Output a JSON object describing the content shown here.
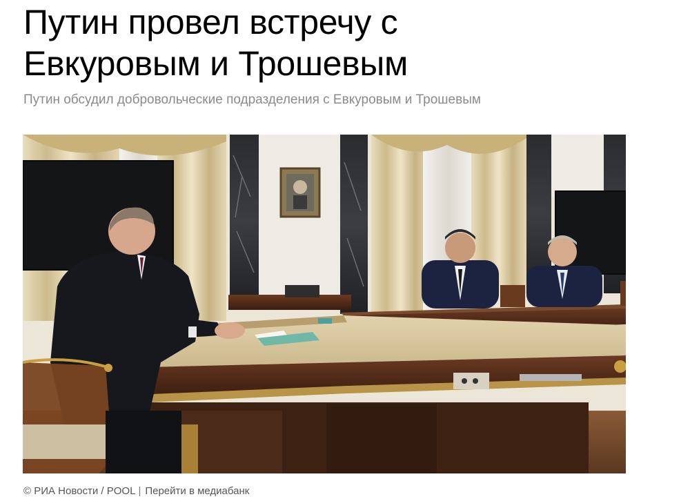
{
  "article": {
    "headline": "Путин провел встречу с Евкуровым и Трошевым",
    "subtitle": "Путин обсудил добровольческие подразделения с Евкуровым и Трошевым"
  },
  "photo": {
    "credit": "© РИА Новости / POOL",
    "separator": "|",
    "mediabank_link": "Перейти в медиабанк"
  }
}
